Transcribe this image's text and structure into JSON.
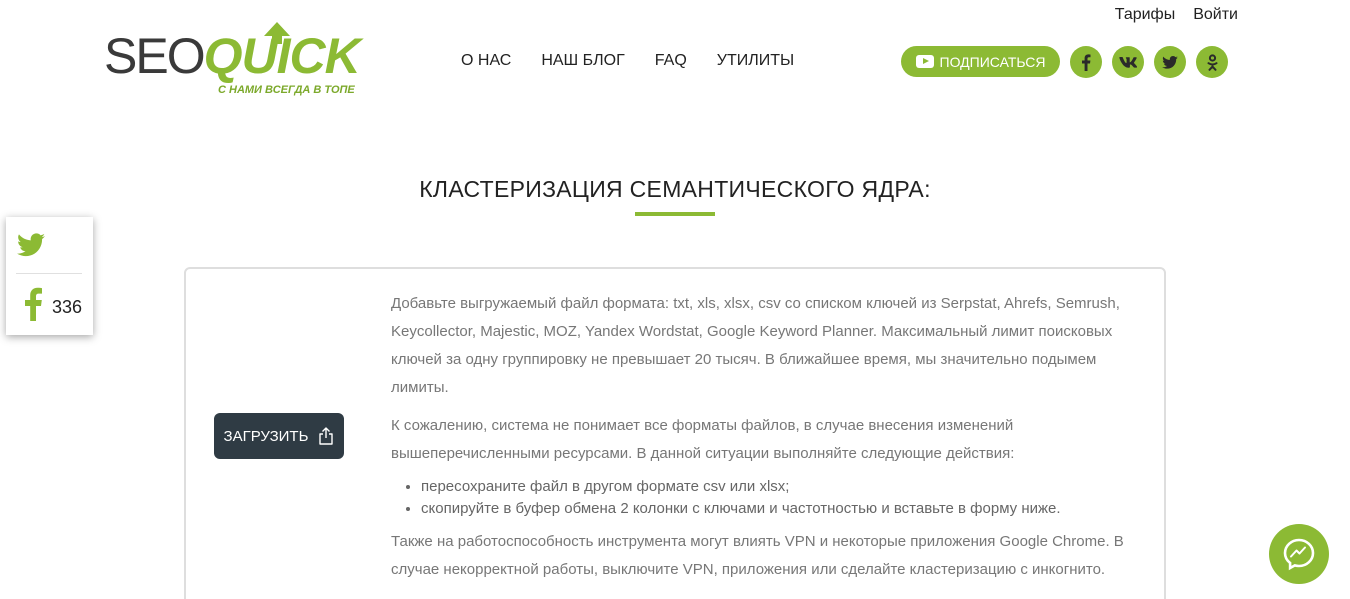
{
  "header": {
    "top_links": [
      {
        "label": "Тарифы"
      },
      {
        "label": "Войти"
      }
    ],
    "logo": {
      "seo": "SEO",
      "quick": "QUICK",
      "tagline": "С НАМИ ВСЕГДА В ТОПЕ"
    },
    "nav": [
      {
        "label": "О НАС"
      },
      {
        "label": "НАШ БЛОГ"
      },
      {
        "label": "FAQ"
      },
      {
        "label": "УТИЛИТЫ"
      }
    ],
    "subscribe_label": "ПОДПИСАТЬСЯ",
    "social_icons": [
      "facebook-icon",
      "vk-icon",
      "twitter-icon",
      "odnoklassniki-icon"
    ]
  },
  "page_title": "КЛАСТЕРИЗАЦИЯ СЕМАНТИЧЕСКОГО ЯДРА:",
  "share_panel": {
    "facebook_count": "336"
  },
  "upload": {
    "label": "ЗАГРУЗИТЬ"
  },
  "content": {
    "paragraph_1": "Добавьте выгружаемый файл формата: txt, xls, xlsx, csv со списком ключей из Serpstat, Ahrefs, Semrush, Keycollector, Majestic, MOZ, Yandex Wordstat, Google Keyword Planner. Максимальный лимит поисковых ключей за одну группировку не превышает 20 тысяч. В ближайшее время, мы значительно подымем лимиты.",
    "paragraph_2": "К сожалению, система не понимает все форматы файлов, в случае внесения изменений вышеперечисленными ресурсами. В данной ситуации выполняйте следующие действия:",
    "list": [
      "пересохраните файл в другом формате csv или xlsx;",
      "скопируйте в буфер обмена 2 колонки с ключами и частотностью и вставьте в форму ниже."
    ],
    "paragraph_3": "Также на работоспособность инструмента могут влиять VPN и некоторые приложения Google Chrome. В случае некорректной работы, выключите VPN, приложения или сделайте кластеризацию с инкогнито."
  },
  "colors": {
    "accent": "#8cba34",
    "dark_button": "#2f3b44"
  }
}
